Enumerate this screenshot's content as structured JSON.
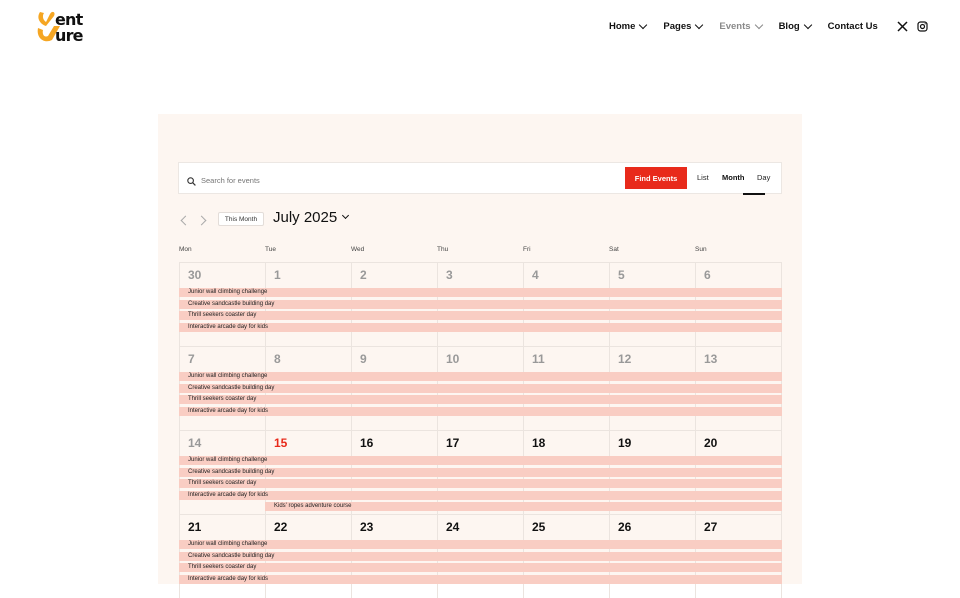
{
  "brand": {
    "logo_line1": "ent",
    "logo_line2": "ure",
    "accent_color": "#f5a623"
  },
  "nav": {
    "items": [
      {
        "label": "Home",
        "has_dropdown": true
      },
      {
        "label": "Pages",
        "has_dropdown": true
      },
      {
        "label": "Events",
        "has_dropdown": true,
        "current": true
      },
      {
        "label": "Blog",
        "has_dropdown": true
      },
      {
        "label": "Contact Us",
        "has_dropdown": false
      }
    ],
    "social": [
      "x-icon",
      "instagram-icon"
    ]
  },
  "calendar": {
    "search": {
      "placeholder": "Search for events",
      "value": ""
    },
    "find_button": "Find Events",
    "views": [
      "List",
      "Month",
      "Day"
    ],
    "active_view": "Month",
    "this_month_label": "This Month",
    "month_label": "July 2025",
    "weekdays": [
      "Mon",
      "Tue",
      "Wed",
      "Thu",
      "Fri",
      "Sat",
      "Sun"
    ],
    "weeks": [
      {
        "days": [
          "30",
          "1",
          "2",
          "3",
          "4",
          "5",
          "6"
        ],
        "past": [
          true,
          true,
          true,
          true,
          true,
          true,
          true
        ],
        "today_index": -1
      },
      {
        "days": [
          "7",
          "8",
          "9",
          "10",
          "11",
          "12",
          "13"
        ],
        "past": [
          true,
          true,
          true,
          true,
          true,
          true,
          true
        ],
        "today_index": -1
      },
      {
        "days": [
          "14",
          "15",
          "16",
          "17",
          "18",
          "19",
          "20"
        ],
        "past": [
          true,
          false,
          false,
          false,
          false,
          false,
          false
        ],
        "today_index": 1
      },
      {
        "days": [
          "21",
          "22",
          "23",
          "24",
          "25",
          "26",
          "27"
        ],
        "past": [
          false,
          false,
          false,
          false,
          false,
          false,
          false
        ],
        "today_index": -1
      }
    ],
    "recurring_events": [
      "Junior wall climbing challenge",
      "Creative sandcastle building day",
      "Thrill seekers coaster day",
      "Interactive arcade day for kids"
    ],
    "extra_event": {
      "title": "Kids' ropes adventure course",
      "week_index": 2,
      "start_day_index": 1
    },
    "colors": {
      "event_bg": "#f9cdc3",
      "today": "#e82a1b",
      "button": "#e82a1b",
      "panel_bg": "#fdf6f1"
    }
  }
}
